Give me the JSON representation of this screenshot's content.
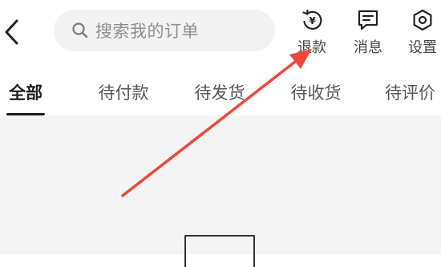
{
  "search": {
    "placeholder": "搜索我的订单",
    "icon": "search-icon"
  },
  "actions": [
    {
      "label": "退款",
      "icon": "refund-yen-icon"
    },
    {
      "label": "消息",
      "icon": "message-icon"
    },
    {
      "label": "设置",
      "icon": "settings-hexagon-icon"
    }
  ],
  "tabs": [
    {
      "label": "全部",
      "active": true
    },
    {
      "label": "待付款"
    },
    {
      "label": "待发货"
    },
    {
      "label": "待收货"
    },
    {
      "label": "待评价"
    }
  ],
  "refund_icon_glyph": "¥",
  "colors": {
    "annotation_arrow": "#f0463a",
    "content_background": "#f4f4f4",
    "search_background": "#f2f2f2"
  }
}
